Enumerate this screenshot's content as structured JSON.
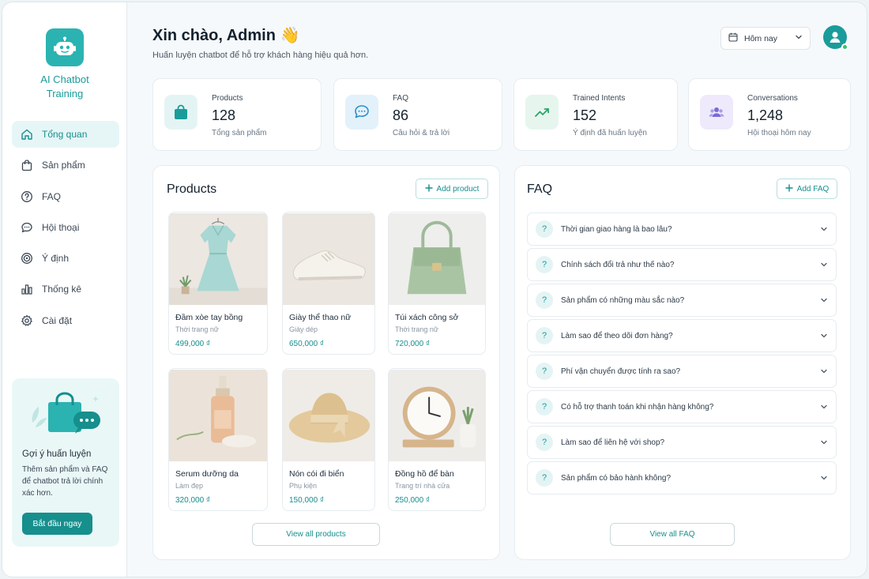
{
  "sidebar": {
    "brand_line1": "AI Chatbot",
    "brand_line2": "Training",
    "items": [
      {
        "label": "Tổng quan",
        "icon": "home-icon"
      },
      {
        "label": "Sản phẩm",
        "icon": "bag-icon"
      },
      {
        "label": "FAQ",
        "icon": "help-circle-icon"
      },
      {
        "label": "Hội thoại",
        "icon": "chat-icon"
      },
      {
        "label": "Ý định",
        "icon": "target-icon"
      },
      {
        "label": "Thống kê",
        "icon": "bar-chart-icon"
      },
      {
        "label": "Cài đặt",
        "icon": "gear-icon"
      }
    ],
    "tip": {
      "title": "Gợi ý huấn luyện",
      "text": "Thêm sản phẩm và FAQ để chatbot trả lời chính xác hơn.",
      "button": "Bắt đầu ngay"
    }
  },
  "header": {
    "greeting": "Xin chào, Admin 👋",
    "subtitle": "Huấn luyện chatbot để hỗ trợ khách hàng hiệu quả hơn.",
    "date_filter": "Hôm nay"
  },
  "stats": [
    {
      "label": "Products",
      "value": "128",
      "desc": "Tổng sản phẩm",
      "icon": "bag-icon"
    },
    {
      "label": "FAQ",
      "value": "86",
      "desc": "Câu hỏi & trả lời",
      "icon": "chat-icon"
    },
    {
      "label": "Trained Intents",
      "value": "152",
      "desc": "Ý định đã huấn luyện",
      "icon": "trend-up-icon"
    },
    {
      "label": "Conversations",
      "value": "1,248",
      "desc": "Hội thoại hôm nay",
      "icon": "users-icon"
    }
  ],
  "products": {
    "title": "Products",
    "add_label": "Add product",
    "view_all": "View all products",
    "items": [
      {
        "name": "Đầm xòe tay bồng",
        "category": "Thời trang nữ",
        "price": "499,000 ₫"
      },
      {
        "name": "Giày thể thao nữ",
        "category": "Giày dép",
        "price": "650,000 ₫"
      },
      {
        "name": "Túi xách công sở",
        "category": "Thời trang nữ",
        "price": "720,000 ₫"
      },
      {
        "name": "Serum dưỡng da",
        "category": "Làm đẹp",
        "price": "320,000 ₫"
      },
      {
        "name": "Nón cói đi biển",
        "category": "Phụ kiện",
        "price": "150,000 ₫"
      },
      {
        "name": "Đồng hồ để bàn",
        "category": "Trang trí nhà cửa",
        "price": "250,000 ₫"
      }
    ]
  },
  "faq": {
    "title": "FAQ",
    "add_label": "Add FAQ",
    "view_all": "View all FAQ",
    "items": [
      "Thời gian giao hàng là bao lâu?",
      "Chính sách đổi trả như thế nào?",
      "Sản phẩm có những màu sắc nào?",
      "Làm sao để theo dõi đơn hàng?",
      "Phí vận chuyển được tính ra sao?",
      "Có hỗ trợ thanh toán khi nhận hàng không?",
      "Làm sao để liên hệ với shop?",
      "Sản phẩm có bảo hành không?"
    ]
  },
  "colors": {
    "accent": "#1a9c9a",
    "accent_dark": "#168f8d",
    "online": "#34c36a"
  }
}
